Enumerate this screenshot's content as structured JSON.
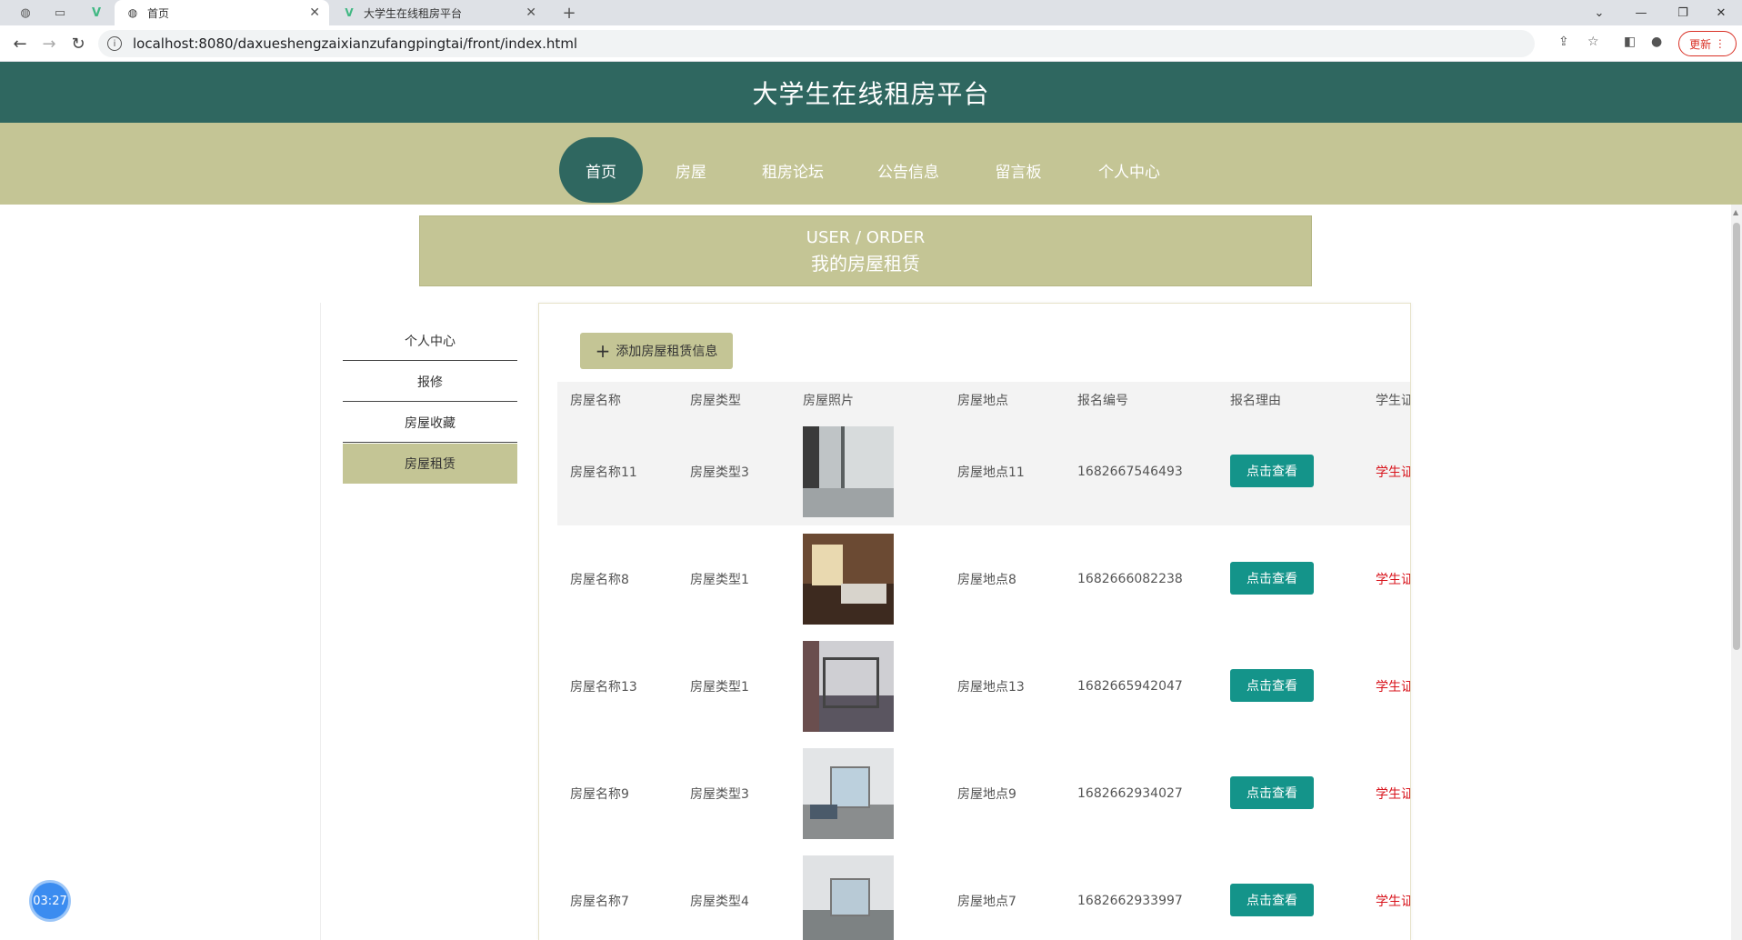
{
  "browser": {
    "tabs": [
      {
        "title": "首页",
        "active": true
      },
      {
        "title": "大学生在线租房平台",
        "active": false
      }
    ],
    "url": "localhost:8080/daxueshengzaixianzufangpingtai/front/index.html",
    "update_label": "更新"
  },
  "site": {
    "title": "大学生在线租房平台",
    "nav": [
      "首页",
      "房屋",
      "租房论坛",
      "公告信息",
      "留言板",
      "个人中心"
    ],
    "active_nav": "首页"
  },
  "banner": {
    "en": "USER / ORDER",
    "cn": "我的房屋租赁"
  },
  "sidebar": {
    "items": [
      "个人中心",
      "报修",
      "房屋收藏",
      "房屋租赁"
    ],
    "active": "房屋租赁"
  },
  "main": {
    "add_button_label": "添加房屋租赁信息",
    "columns": [
      "房屋名称",
      "房屋类型",
      "房屋照片",
      "房屋地点",
      "报名编号",
      "报名理由",
      "学生证"
    ],
    "rows": [
      {
        "name": "房屋名称11",
        "type": "房屋类型3",
        "location": "房屋地点11",
        "number": "1682667546493",
        "reason": "点击查看",
        "student": "学生证"
      },
      {
        "name": "房屋名称8",
        "type": "房屋类型1",
        "location": "房屋地点8",
        "number": "1682666082238",
        "reason": "点击查看",
        "student": "学生证"
      },
      {
        "name": "房屋名称13",
        "type": "房屋类型1",
        "location": "房屋地点13",
        "number": "1682665942047",
        "reason": "点击查看",
        "student": "学生证"
      },
      {
        "name": "房屋名称9",
        "type": "房屋类型3",
        "location": "房屋地点9",
        "number": "1682662934027",
        "reason": "点击查看",
        "student": "学生证"
      },
      {
        "name": "房屋名称7",
        "type": "房屋类型4",
        "location": "房屋地点7",
        "number": "1682662933997",
        "reason": "点击查看",
        "student": "学生证"
      }
    ]
  },
  "timer": "03:27",
  "colors": {
    "header": "#2f6760",
    "nav": "#c4c595",
    "button": "#14948a",
    "link_red": "#d8141c"
  }
}
